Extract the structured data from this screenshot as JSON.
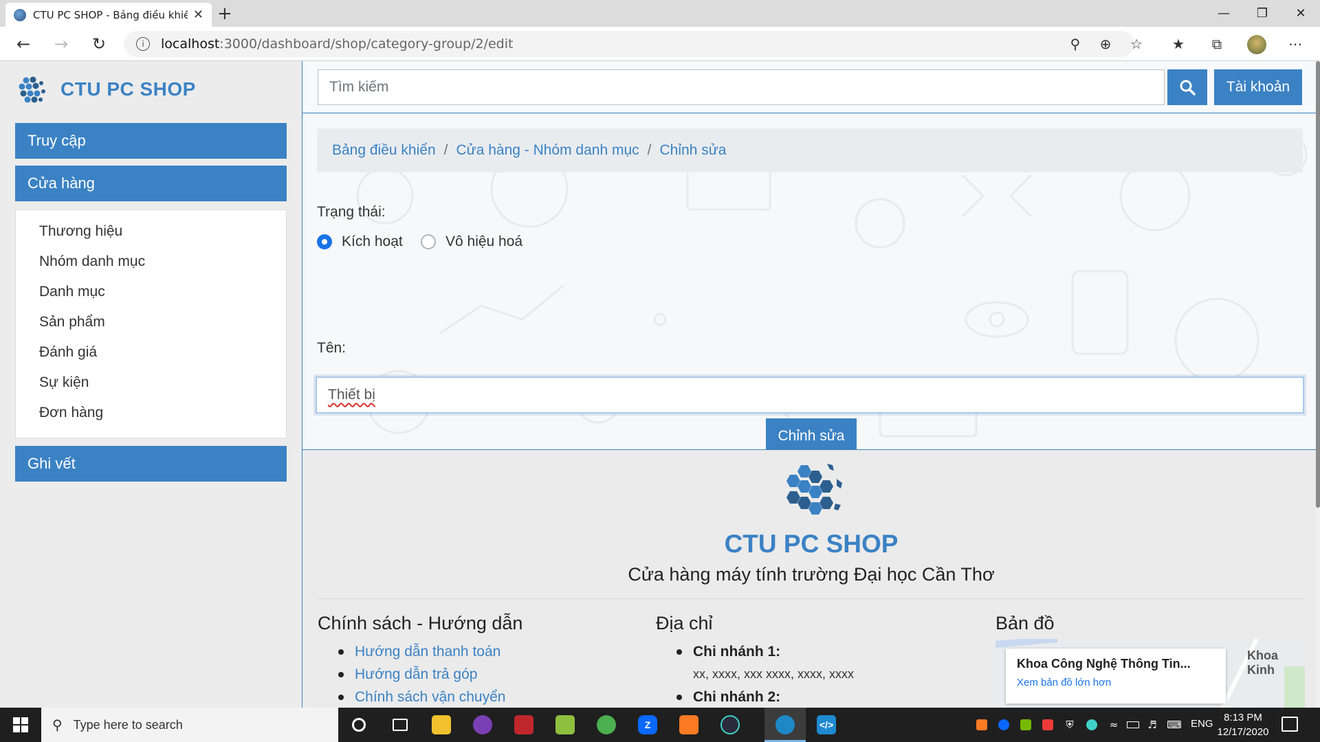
{
  "browser": {
    "tab_title": "CTU PC SHOP - Bảng điều khiển",
    "url_host": "localhost",
    "url_path": ":3000/dashboard/shop/category-group/2/edit"
  },
  "sidebar": {
    "brand": "CTU PC SHOP",
    "menu": {
      "access": "Truy cập",
      "shop": "Cửa hàng",
      "log": "Ghi vết"
    },
    "shop_items": [
      "Thương hiệu",
      "Nhóm danh mục",
      "Danh mục",
      "Sản phẩm",
      "Đánh giá",
      "Sự kiện",
      "Đơn hàng"
    ]
  },
  "header": {
    "search_placeholder": "Tìm kiếm",
    "account_label": "Tài khoản"
  },
  "breadcrumb": [
    "Bảng điều khiển",
    "Cửa hàng - Nhóm danh mục",
    "Chỉnh sửa"
  ],
  "form": {
    "status_label": "Trạng thái:",
    "status_options": [
      "Kích hoạt",
      "Vô hiệu hoá"
    ],
    "status_selected": "Kích hoạt",
    "name_label": "Tên:",
    "name_value": "Thiết bị",
    "submit_label": "Chỉnh sửa"
  },
  "footer": {
    "shop_name": "CTU PC SHOP",
    "tagline": "Cửa hàng máy tính trường Đại học Cần Thơ",
    "policy": {
      "title": "Chính sách - Hướng dẫn",
      "links": [
        "Hướng dẫn thanh toán",
        "Hướng dẫn trả góp",
        "Chính sách vận chuyển"
      ]
    },
    "address": {
      "title": "Địa chỉ",
      "branch1_label": "Chi nhánh 1:",
      "branch1_value": "xx, xxxx, xxx xxxx, xxxx, xxxx",
      "branch2_label": "Chi nhánh 2:"
    },
    "map": {
      "title": "Bản đồ",
      "place_name": "Khoa Công Nghệ Thông Tin...",
      "larger_map": "Xem bản đồ lớn hơn",
      "nearby": "Khoa Kinh"
    }
  },
  "taskbar": {
    "search_placeholder": "Type here to search",
    "language": "ENG",
    "time": "8:13 PM",
    "date": "12/17/2020"
  }
}
